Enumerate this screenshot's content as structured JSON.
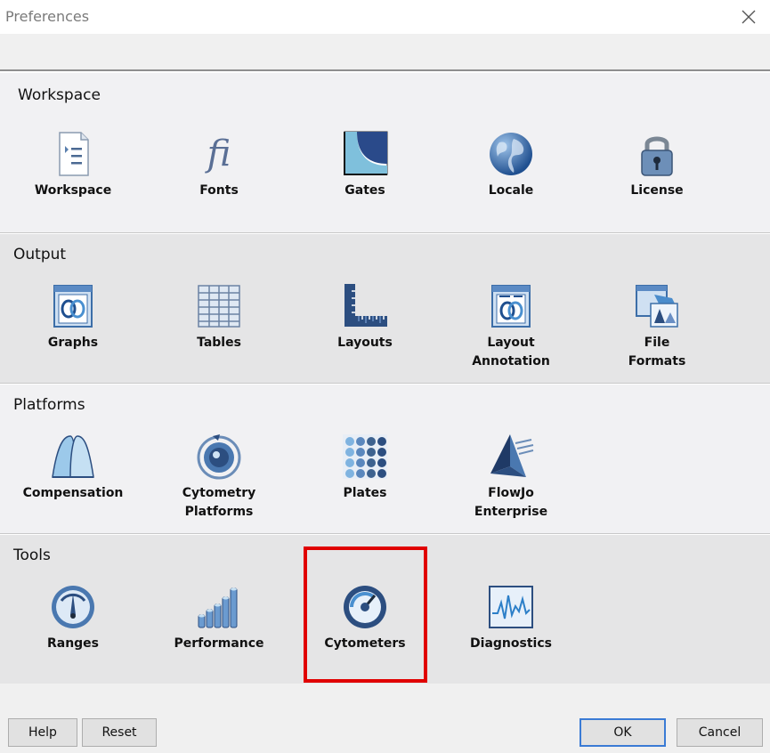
{
  "window": {
    "title": "Preferences"
  },
  "sections": {
    "workspace": {
      "title": "Workspace",
      "items": [
        {
          "label": "Workspace",
          "icon": "workspace-document-icon"
        },
        {
          "label": "Fonts",
          "icon": "fonts-fi-icon"
        },
        {
          "label": "Gates",
          "icon": "gates-icon"
        },
        {
          "label": "Locale",
          "icon": "globe-icon"
        },
        {
          "label": "License",
          "icon": "padlock-icon"
        }
      ]
    },
    "output": {
      "title": "Output",
      "items": [
        {
          "label": "Graphs",
          "icon": "graph-icon"
        },
        {
          "label": "Tables",
          "icon": "table-grid-icon"
        },
        {
          "label": "Layouts",
          "icon": "layout-ruler-icon"
        },
        {
          "label": "Layout\nAnnotation",
          "icon": "layout-annotation-icon"
        },
        {
          "label": "File\nFormats",
          "icon": "file-formats-icon"
        }
      ]
    },
    "platforms": {
      "title": "Platforms",
      "items": [
        {
          "label": "Compensation",
          "icon": "compensation-icon"
        },
        {
          "label": "Cytometry\nPlatforms",
          "icon": "cytometry-platforms-icon"
        },
        {
          "label": "Plates",
          "icon": "plates-icon"
        },
        {
          "label": "FlowJo\nEnterprise",
          "icon": "pyramid-icon"
        }
      ]
    },
    "tools": {
      "title": "Tools",
      "items": [
        {
          "label": "Ranges",
          "icon": "gauge-icon"
        },
        {
          "label": "Performance",
          "icon": "bar-cylinders-icon"
        },
        {
          "label": "Cytometers",
          "icon": "cytometer-dial-icon"
        },
        {
          "label": "Diagnostics",
          "icon": "waveform-monitor-icon"
        }
      ]
    }
  },
  "footer": {
    "help": "Help",
    "reset": "Reset",
    "ok": "OK",
    "cancel": "Cancel"
  },
  "colors": {
    "highlight": "#e00000",
    "icon_blue": "#4a78b0",
    "ok_border": "#3a7bd5"
  }
}
